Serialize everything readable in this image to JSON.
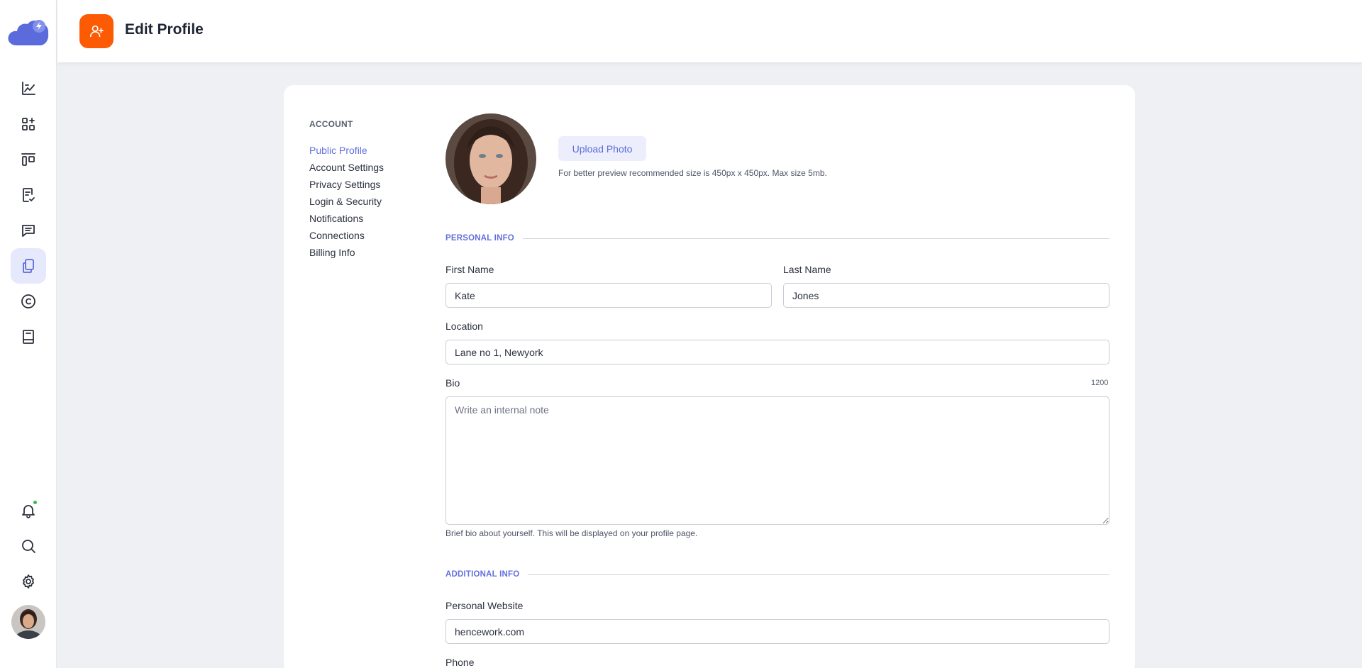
{
  "header": {
    "title": "Edit Profile"
  },
  "account_menu": {
    "heading": "ACCOUNT",
    "items": [
      {
        "label": "Public Profile"
      },
      {
        "label": "Account Settings"
      },
      {
        "label": "Privacy Settings"
      },
      {
        "label": "Login & Security"
      },
      {
        "label": "Notifications"
      },
      {
        "label": "Connections"
      },
      {
        "label": "Billing Info"
      }
    ],
    "active_item": "Public Profile"
  },
  "sidebar": {
    "icons": [
      "analytics-icon",
      "apps-icon",
      "board-icon",
      "tasks-icon",
      "chat-icon",
      "files-icon",
      "copyright-icon",
      "book-icon"
    ],
    "bottom_icons": [
      "bell-icon",
      "search-icon",
      "gear-icon"
    ],
    "active_icon": "files-icon",
    "notification_dot_color": "#2dbf4e"
  },
  "photo": {
    "upload_label": "Upload Photo",
    "hint": "For better preview recommended size is 450px x 450px. Max size 5mb."
  },
  "personal_info": {
    "section_title": "PERSONAL INFO",
    "first_name_label": "First Name",
    "first_name_value": "Kate",
    "last_name_label": "Last Name",
    "last_name_value": "Jones",
    "location_label": "Location",
    "location_value": "Lane no 1, Newyork",
    "bio_label": "Bio",
    "bio_counter": "1200",
    "bio_placeholder": "Write an internal note",
    "bio_hint": "Brief bio about yourself. This will be displayed on your profile page."
  },
  "additional_info": {
    "section_title": "ADDITIONAL INFO",
    "website_label": "Personal Website",
    "website_value": "hencework.com",
    "phone_label": "Phone"
  },
  "colors": {
    "accent": "#6270dc",
    "brand_orange": "#fc5a03",
    "logo_blue": "#5b6bdc"
  }
}
